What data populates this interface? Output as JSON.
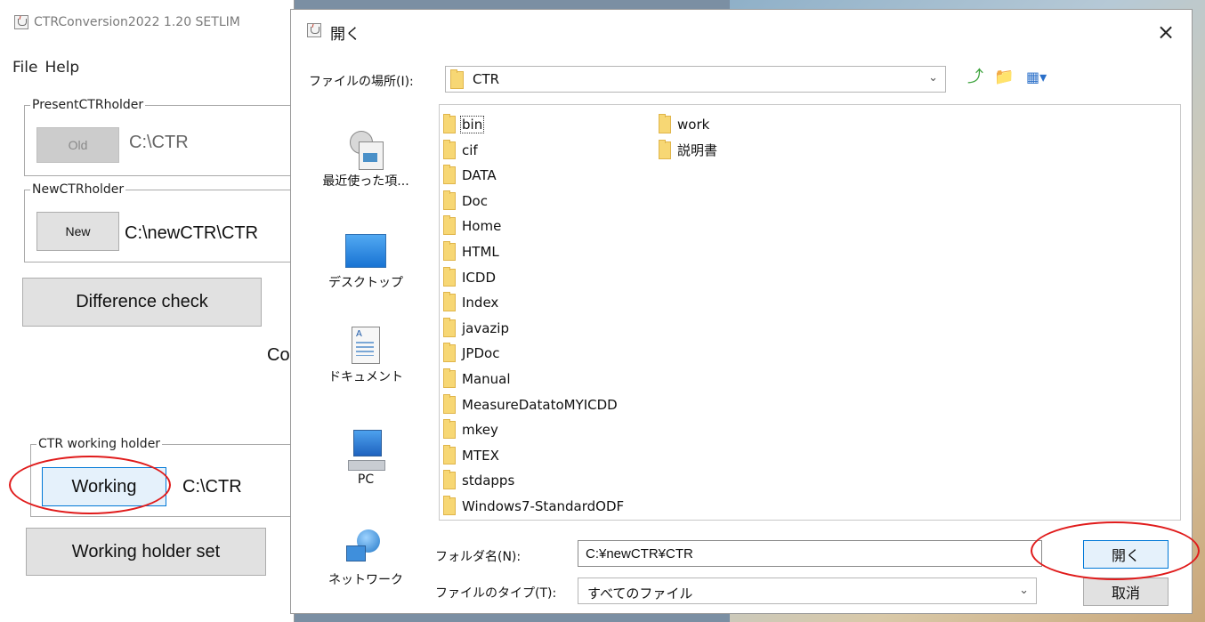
{
  "main_window": {
    "title": "CTRConversion2022 1.20 SETLIM",
    "menu": [
      "File",
      "Help"
    ],
    "present_group": {
      "legend": "PresentCTRholder",
      "button": "Old",
      "path": "C:\\CTR"
    },
    "new_group": {
      "legend": "NewCTRholder",
      "button": "New",
      "path": "C:\\newCTR\\CTR"
    },
    "difference_check": "Difference check",
    "truncated_label": "Co",
    "working_group": {
      "legend": "CTR working holder",
      "button": "Working",
      "path": "C:\\CTR"
    },
    "working_holder_set": "Working holder set"
  },
  "dialog": {
    "title": "開く",
    "close": "×",
    "look_in_label": "ファイルの場所(I):",
    "look_in_value": "CTR",
    "places": [
      "最近使った項...",
      "デスクトップ",
      "ドキュメント",
      "PC",
      "ネットワーク"
    ],
    "files_col1": [
      "bin",
      "cif",
      "DATA",
      "Doc",
      "Home",
      "HTML",
      "ICDD",
      "Index",
      "javazip",
      "JPDoc",
      "Manual",
      "MeasureDatatoMYICDD",
      "mkey",
      "MTEX",
      "stdapps",
      "Windows7-StandardODF"
    ],
    "files_col2": [
      "work",
      "説明書"
    ],
    "folder_name_label": "フォルダ名(N):",
    "folder_name_value": "C:¥newCTR¥CTR",
    "file_type_label": "ファイルのタイプ(T):",
    "file_type_value": "すべてのファイル",
    "open_button": "開く",
    "cancel_button": "取消"
  },
  "annotations": {
    "highlight_color": "#e01b1b"
  },
  "icons": [
    "java-icon",
    "folder-icon",
    "up-folder-icon",
    "new-folder-icon",
    "view-menu-icon",
    "recent-items-icon",
    "desktop-icon",
    "documents-icon",
    "pc-icon",
    "network-icon",
    "chevron-down-icon",
    "close-icon"
  ]
}
